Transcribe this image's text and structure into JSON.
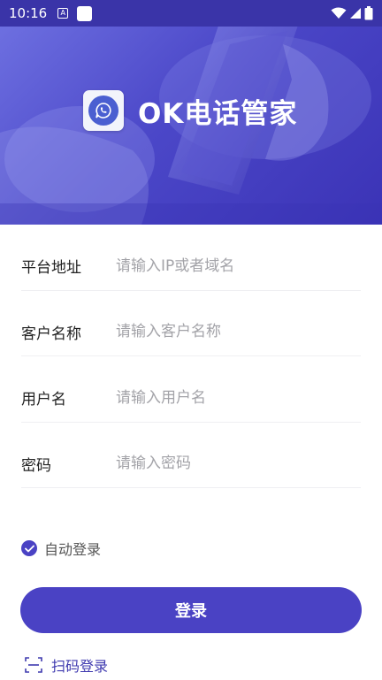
{
  "status_bar": {
    "time": "10:16",
    "notification_letter": "A",
    "icons": [
      "notification-icon",
      "app-icon",
      "wifi-icon",
      "signal-icon",
      "battery-icon"
    ]
  },
  "header": {
    "app_name": "OK电话管家",
    "logo_icon": "phone-chat-icon"
  },
  "form": {
    "fields": [
      {
        "label": "平台地址",
        "placeholder": "请输入IP或者域名",
        "value": ""
      },
      {
        "label": "客户名称",
        "placeholder": "请输入客户名称",
        "value": ""
      },
      {
        "label": "用户名",
        "placeholder": "请输入用户名",
        "value": ""
      },
      {
        "label": "密码",
        "placeholder": "请输入密码",
        "value": ""
      }
    ],
    "auto_login": {
      "label": "自动登录",
      "checked": true
    },
    "login_button": "登录",
    "scan_login": "扫码登录"
  },
  "colors": {
    "accent": "#4a42c4",
    "status_bar": "#3a34a8",
    "hero": "#4b47c8",
    "placeholder": "#a3a3a8"
  }
}
